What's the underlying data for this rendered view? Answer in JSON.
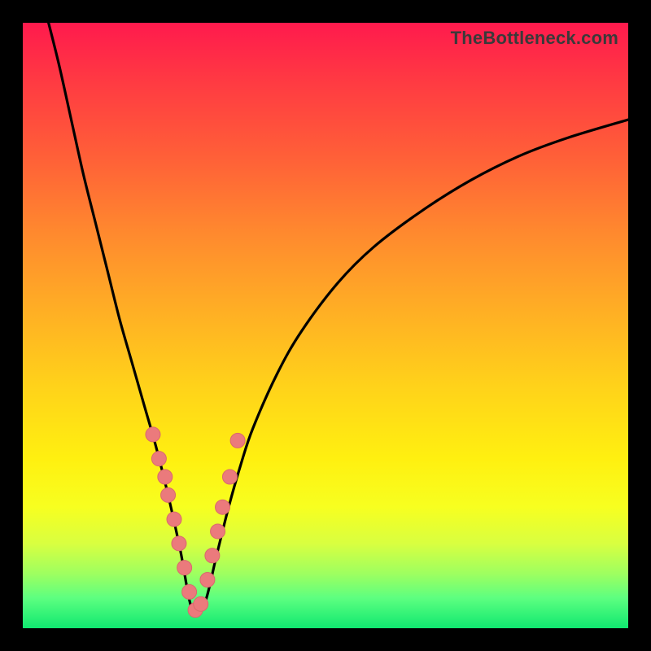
{
  "watermark": "TheBottleneck.com",
  "colors": {
    "frame": "#000000",
    "curve": "#000000",
    "marker_fill": "#eb7a7c",
    "marker_stroke": "#d96a6c"
  },
  "chart_data": {
    "type": "line",
    "title": "",
    "xlabel": "",
    "ylabel": "",
    "xlim": [
      0,
      100
    ],
    "ylim": [
      0,
      100
    ],
    "grid": false,
    "legend": false,
    "note": "Axes unlabeled; values are estimated positions on a 0–100 normalized scale. Curve shows bottleneck mismatch (high=red/bad, low=green/good) with minimum near x≈28.",
    "series": [
      {
        "name": "bottleneck-curve",
        "x": [
          4,
          6,
          8,
          10,
          12,
          14,
          16,
          18,
          20,
          22,
          24,
          26,
          28,
          30,
          32,
          34,
          36,
          38,
          42,
          46,
          52,
          58,
          66,
          74,
          82,
          90,
          100
        ],
        "y": [
          101,
          93,
          84,
          75,
          67,
          59,
          51,
          44,
          37,
          30,
          22,
          13,
          3,
          4,
          12,
          20,
          27,
          33,
          42,
          49,
          57,
          63,
          69,
          74,
          78,
          81,
          84
        ]
      }
    ],
    "markers": {
      "name": "highlighted-points",
      "x": [
        21.5,
        22.5,
        23.5,
        24.0,
        25.0,
        25.8,
        26.7,
        27.5,
        28.5,
        29.4,
        30.5,
        31.3,
        32.2,
        33.0,
        34.2,
        35.5
      ],
      "y": [
        32,
        28,
        25,
        22,
        18,
        14,
        10,
        6,
        3,
        4,
        8,
        12,
        16,
        20,
        25,
        31
      ]
    }
  }
}
